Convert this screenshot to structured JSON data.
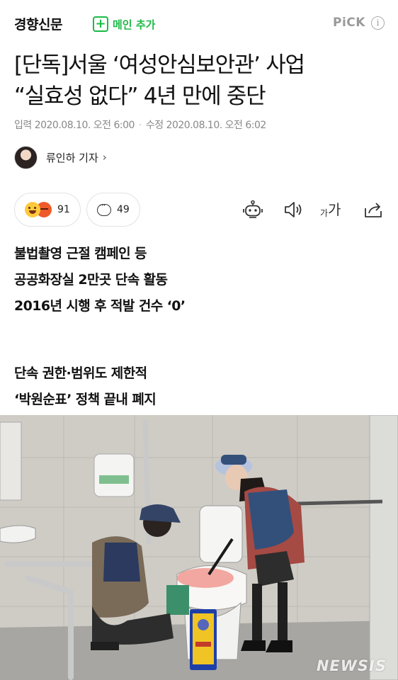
{
  "header": {
    "press_name": "경향신문",
    "main_add_label": "메인 추가",
    "pick_label": "PiCK",
    "info_label": "i"
  },
  "article": {
    "headline_line1": "[단독]서울 ‘여성안심보안관’ 사업",
    "headline_line2": "“실효성 없다” 4년 만에 중단",
    "input_date": "입력 2020.08.10. 오전 6:00",
    "modified_date": "수정 2020.08.10. 오전 6:02",
    "reporter": "류인하 기자",
    "reaction_count": "91",
    "comment_count": "49",
    "font_size_small": "가",
    "font_size_large": "가",
    "summary": [
      "불법촬영 근절 캠페인 등",
      "공공화장실 2만곳 단속 활동",
      "2016년 시행 후 적발 건수 ‘0’",
      "",
      "단속 권한·범위도 제한적",
      "‘박원순표’ 정책 끝내 폐지"
    ],
    "photo_watermark": "NEWSIS"
  }
}
